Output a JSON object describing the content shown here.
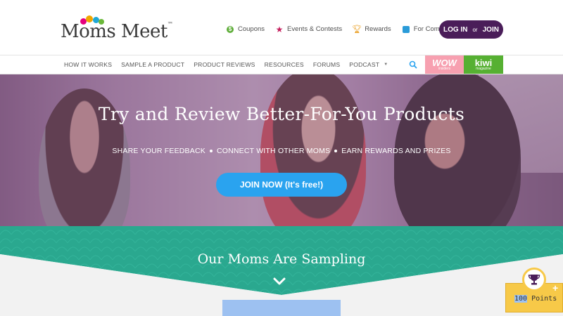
{
  "header": {
    "logo_text": "Moms Meet",
    "links": [
      {
        "label": "Coupons",
        "icon": "coupon-dollar-icon"
      },
      {
        "label": "Events & Contests",
        "icon": "star-icon"
      },
      {
        "label": "Rewards",
        "icon": "trophy-icon"
      },
      {
        "label": "For Companies",
        "icon": "briefcase-icon"
      }
    ],
    "login_label": "LOG IN",
    "or_label": "or",
    "join_label": "JOIN"
  },
  "nav": {
    "items": [
      "HOW IT WORKS",
      "SAMPLE A PRODUCT",
      "PRODUCT REVIEWS",
      "RESOURCES",
      "FORUMS",
      "PODCAST"
    ],
    "wow_label": "WOW",
    "wow_sub": "insiders",
    "kiwi_label": "kiwi",
    "kiwi_sub": "magazine"
  },
  "hero": {
    "title": "Try and Review Better-For-You Products",
    "sub": [
      "SHARE YOUR FEEDBACK",
      "CONNECT WITH OTHER MOMS",
      "EARN REWARDS AND PRIZES"
    ],
    "cta": "JOIN NOW (It's free!)"
  },
  "sampling": {
    "title": "Our Moms Are Sampling"
  },
  "points": {
    "value": "100",
    "label": "Points",
    "plus": "+"
  },
  "colors": {
    "brand_purple": "#4a1d59",
    "teal": "#2aa88f",
    "cta_blue": "#2aa3ef",
    "gold": "#f7c948"
  }
}
